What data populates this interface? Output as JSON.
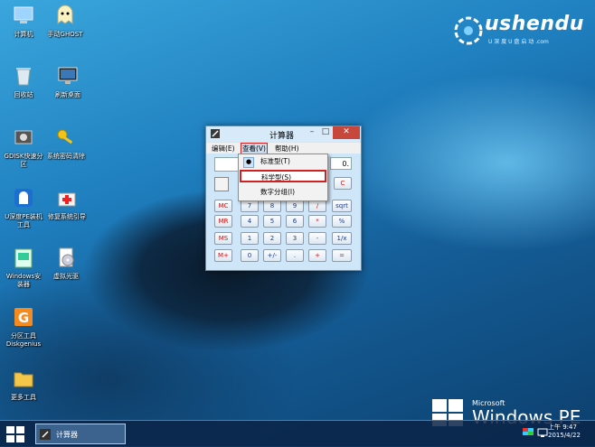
{
  "desktop": {
    "icons": [
      {
        "label": "计算机",
        "icon": "computer-icon"
      },
      {
        "label": "手动GHOST",
        "icon": "ghost-icon"
      },
      {
        "label": "回收站",
        "icon": "recycle-bin-icon"
      },
      {
        "label": "刷新桌面",
        "icon": "monitor-icon"
      },
      {
        "label": "GDISK快速分",
        "label2": "区",
        "icon": "gdisk-icon"
      },
      {
        "label": "系统密码清除",
        "icon": "key-icon"
      },
      {
        "label": "U深度PE装机",
        "label2": "工具",
        "icon": "ushendu-pe-icon"
      },
      {
        "label": "修复系统引导",
        "icon": "repair-icon"
      },
      {
        "label": "Windows安",
        "label2": "装器",
        "icon": "windows-installer-icon"
      },
      {
        "label": "虚拟光驱",
        "icon": "virtual-drive-icon"
      },
      {
        "label": "分区工具",
        "label2": "Diskgenius",
        "icon": "diskgenius-icon"
      },
      {
        "label": "更多工具",
        "icon": "folder-icon"
      }
    ]
  },
  "logo": {
    "text": "ushendu",
    "subtitle": "U 深 度 U 盘 启 动   .com"
  },
  "watermark": {
    "microsoft": "Microsoft",
    "windowspe": "Windows PE"
  },
  "calculator": {
    "title": "计算器",
    "menu": {
      "edit": "编辑(E)",
      "view": "查看(V)",
      "help": "帮助(H)"
    },
    "display": "0.",
    "dropdown": {
      "standard": "标准型(T)",
      "scientific": "科学型(S)",
      "digit_grouping": "数字分组(I)"
    },
    "keys": {
      "row1": [
        "MC",
        "7",
        "8",
        "9",
        "/",
        "sqrt"
      ],
      "row2": [
        "MR",
        "4",
        "5",
        "6",
        "*",
        "%"
      ],
      "row3": [
        "MS",
        "1",
        "2",
        "3",
        "-",
        "1/x"
      ],
      "row4": [
        "M+",
        "0",
        "+/-",
        ".",
        "+",
        "="
      ],
      "clear": "C"
    }
  },
  "taskbar": {
    "task_label": "计算器",
    "time": "上午 9:47",
    "date": "2015/4/22"
  },
  "colors": {
    "highlight": "#d02020",
    "taskbar": "#0a2346",
    "accent": "#2f8fd0"
  }
}
